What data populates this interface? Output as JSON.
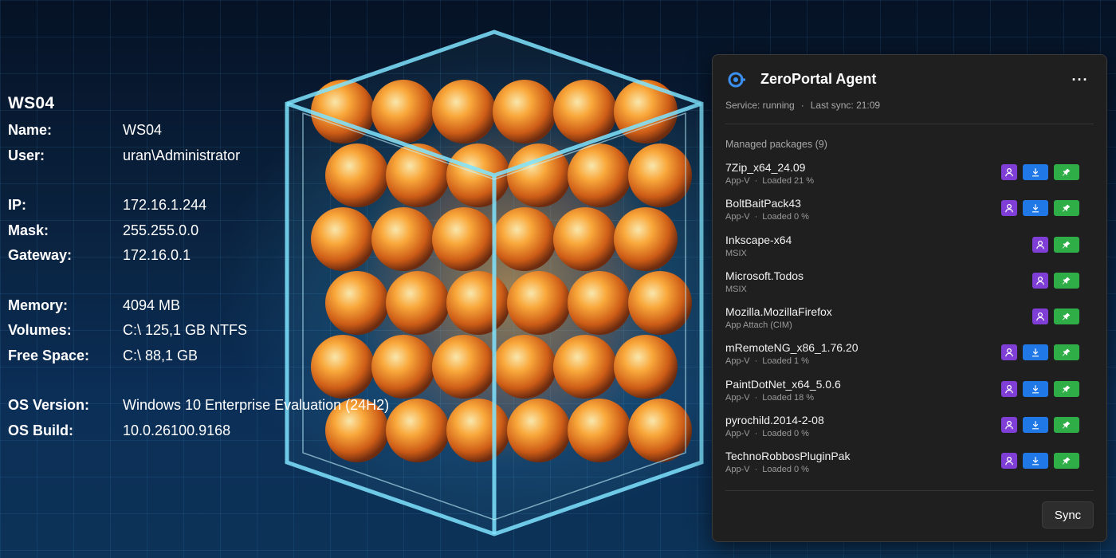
{
  "desktop": {
    "bginfo": {
      "hostname": "WS04",
      "groups": [
        [
          {
            "label": "Name:",
            "value": "WS04"
          },
          {
            "label": "User:",
            "value": "uran\\Administrator"
          }
        ],
        [
          {
            "label": "IP:",
            "value": "172.16.1.244"
          },
          {
            "label": "Mask:",
            "value": "255.255.0.0"
          },
          {
            "label": "Gateway:",
            "value": "172.16.0.1"
          }
        ],
        [
          {
            "label": "Memory:",
            "value": "4094 MB"
          },
          {
            "label": "Volumes:",
            "value": "C:\\ 125,1 GB NTFS"
          },
          {
            "label": "Free Space:",
            "value": "C:\\ 88,1 GB"
          }
        ],
        [
          {
            "label": "OS Version:",
            "value": "Windows 10 Enterprise Evaluation (24H2)"
          },
          {
            "label": "OS Build:",
            "value": "10.0.26100.9168"
          }
        ]
      ]
    }
  },
  "panel": {
    "title": "ZeroPortal Agent",
    "more_label": "···",
    "service_status": "Service: running",
    "last_sync": "Last sync: 21:09",
    "separator": "·",
    "section_label": "Managed packages (9)",
    "sync_label": "Sync",
    "colors": {
      "user_action": "#7f3fd6",
      "download_action": "#1f78e6",
      "pin_action": "#2fae48",
      "panel_bg": "#1f1f1f"
    },
    "packages": [
      {
        "name": "7Zip_x64_24.09",
        "type": "App-V",
        "status": "Loaded 21 %",
        "actions": [
          "user",
          "download",
          "pin"
        ]
      },
      {
        "name": "BoltBaitPack43",
        "type": "App-V",
        "status": "Loaded 0 %",
        "actions": [
          "user",
          "download",
          "pin"
        ]
      },
      {
        "name": "Inkscape-x64",
        "type": "MSIX",
        "status": "",
        "actions": [
          "user",
          "pin"
        ]
      },
      {
        "name": "Microsoft.Todos",
        "type": "MSIX",
        "status": "",
        "actions": [
          "user",
          "pin"
        ]
      },
      {
        "name": "Mozilla.MozillaFirefox",
        "type": "App Attach (CIM)",
        "status": "",
        "actions": [
          "user",
          "pin"
        ]
      },
      {
        "name": "mRemoteNG_x86_1.76.20",
        "type": "App-V",
        "status": "Loaded 1 %",
        "actions": [
          "user",
          "download",
          "pin"
        ]
      },
      {
        "name": "PaintDotNet_x64_5.0.6",
        "type": "App-V",
        "status": "Loaded 18 %",
        "actions": [
          "user",
          "download",
          "pin"
        ]
      },
      {
        "name": "pyrochild.2014-2-08",
        "type": "App-V",
        "status": "Loaded 0 %",
        "actions": [
          "user",
          "download",
          "pin"
        ]
      },
      {
        "name": "TechnoRobbosPluginPak",
        "type": "App-V",
        "status": "Loaded 0 %",
        "actions": [
          "user",
          "download",
          "pin"
        ]
      }
    ]
  }
}
